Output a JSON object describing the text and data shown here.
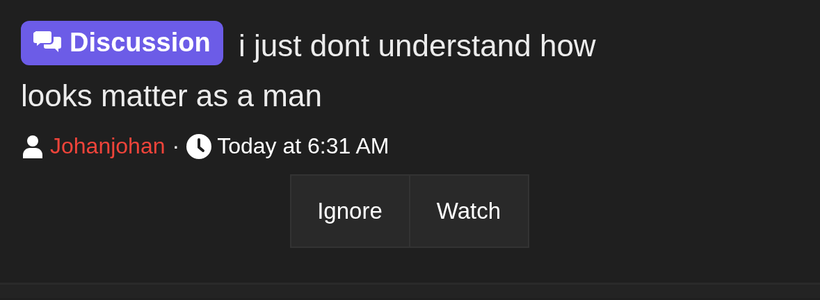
{
  "thread": {
    "prefix": "Discussion",
    "title_lines": [
      "i just dont understand how",
      "looks matter as a man"
    ]
  },
  "meta": {
    "author": "Johanjohan",
    "separator": "·",
    "time": "Today at 6:31 AM"
  },
  "buttons": [
    "Ignore",
    "Watch"
  ]
}
